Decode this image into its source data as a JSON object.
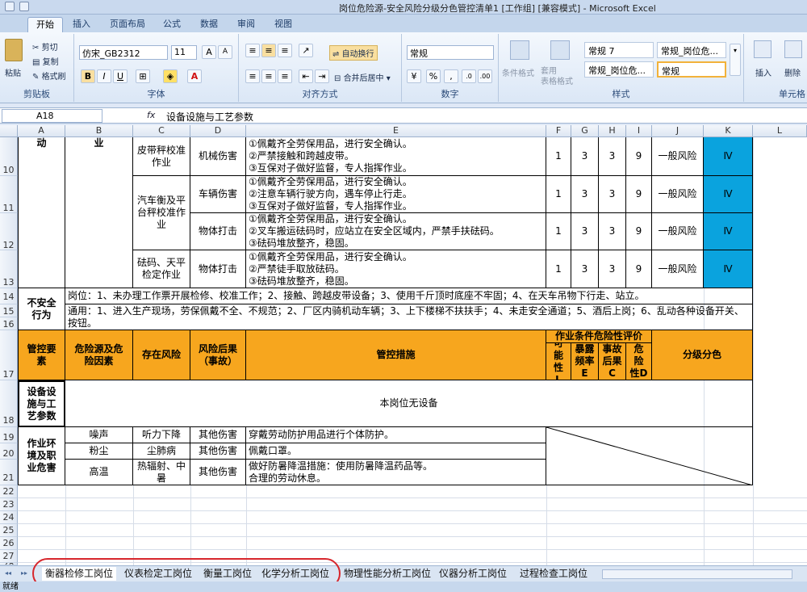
{
  "window": {
    "title": "岗位危险源-安全风险分级分色管控清单1 [工作组] [兼容模式] - Microsoft Excel"
  },
  "ribbon_tabs": [
    "开始",
    "插入",
    "页面布局",
    "公式",
    "数据",
    "审阅",
    "视图"
  ],
  "clipboard": {
    "paste": "粘贴",
    "cut": "剪切",
    "copy": "复制",
    "format_painter": "格式刷",
    "label": "剪贴板"
  },
  "font": {
    "name": "仿宋_GB2312",
    "size": "11",
    "bold": "B",
    "italic": "I",
    "underline": "U",
    "label": "字体"
  },
  "alignment": {
    "wrap": "自动换行",
    "merge": "合并后居中",
    "label": "对齐方式"
  },
  "number": {
    "format": "常规",
    "label": "数字"
  },
  "styles": {
    "cond_format": "条件格式",
    "table_format": "套用\n表格格式",
    "cells": [
      "常规 7",
      "常规_岗位危...",
      "常规_岗位危...",
      "常规"
    ],
    "label": "样式"
  },
  "cells_group": {
    "insert": "插入",
    "delete": "删除",
    "label": "单元格"
  },
  "formula_bar": {
    "name_box": "A18",
    "fx": "fx",
    "content": "设备设施与工艺参数"
  },
  "columns": [
    "A",
    "B",
    "C",
    "D",
    "E",
    "F",
    "G",
    "H",
    "I",
    "J",
    "K",
    "L"
  ],
  "rows": [
    "10",
    "11",
    "12",
    "13",
    "14",
    "15",
    "16",
    "17",
    "18",
    "19",
    "20",
    "21",
    "22",
    "23",
    "24",
    "25",
    "26",
    "27",
    "28"
  ],
  "sheet": {
    "a_top": "动",
    "b_top": "业",
    "r10": {
      "hazard": "皮带秤校准作业",
      "risk": "机械伤害",
      "measures": "①佩戴齐全劳保用品，进行安全确认。\n②严禁接触和跨越皮带。\n③互保对子做好监督，专人指挥作业。",
      "L": "1",
      "E": "3",
      "C": "3",
      "D": "9",
      "level": "一般风险",
      "grade": "Ⅳ"
    },
    "r11": {
      "hazard": "汽车衡及平台秤校准作业",
      "risk": "车辆伤害",
      "measures": "①佩戴齐全劳保用品，进行安全确认。\n②注意车辆行驶方向，遇车停止行走。\n③互保对子做好监督，专人指挥作业。",
      "L": "1",
      "E": "3",
      "C": "3",
      "D": "9",
      "level": "一般风险",
      "grade": "Ⅳ"
    },
    "r12": {
      "risk": "物体打击",
      "measures": "①佩戴齐全劳保用品，进行安全确认。\n②叉车搬运砝码时，应站立在安全区域内，严禁手扶砝码。\n③砝码堆放整齐，稳固。",
      "L": "1",
      "E": "3",
      "C": "3",
      "D": "9",
      "level": "一般风险",
      "grade": "Ⅳ"
    },
    "r13": {
      "hazard": "砝码、天平检定作业",
      "risk": "物体打击",
      "measures": "①佩戴齐全劳保用品，进行安全确认。\n②严禁徒手取放砝码。\n③砝码堆放整齐，稳固。",
      "L": "1",
      "E": "3",
      "C": "3",
      "D": "9",
      "level": "一般风险",
      "grade": "Ⅳ"
    },
    "unsafe": {
      "label": "不安全行为",
      "post": "岗位：1、未办理工作票开展检修、校准工作；2、接触、跨越皮带设备；3、使用千斤顶时底座不牢固；4、在天车吊物下行走、站立。",
      "general": "通用：1、进入生产现场，劳保佩戴不全、不规范；2、厂区内骑机动车辆；3、上下楼梯不扶扶手；4、未走安全通道；5、酒后上岗；6、乱动各种设备开关、按钮。"
    },
    "header": {
      "a": "管控要素",
      "b": "危险源及危险因素",
      "c": "存在风险",
      "d": "风险后果（事故）",
      "e": "管控措施",
      "fi": "作业条件危险性评价",
      "f": "可能性L",
      "g": "暴露频率E",
      "h": "事故后果C",
      "i": "危险性D",
      "jk": "分级分色"
    },
    "equip": {
      "label": "设备设施与工艺参数",
      "text": "本岗位无设备"
    },
    "env": {
      "label": "作业环境及职业危害",
      "rows": [
        {
          "b": "噪声",
          "c": "听力下降",
          "d": "其他伤害",
          "e": "穿戴劳动防护用品进行个体防护。"
        },
        {
          "b": "粉尘",
          "c": "尘肺病",
          "d": "其他伤害",
          "e": "佩戴口罩。"
        },
        {
          "b": "高温",
          "c": "热辐射、中暑",
          "d": "其他伤害",
          "e": "做好防暑降温措施：使用防暑降温药品等。\n合理的劳动休息。"
        }
      ]
    }
  },
  "sheet_tabs": [
    "衡器检修工岗位",
    "仪表检定工岗位",
    "衡量工岗位",
    "化学分析工岗位",
    "物理性能分析工岗位",
    "仪器分析工岗位",
    "过程检查工岗位"
  ],
  "status": {
    "text": "就绪"
  },
  "colors": {
    "orange": "#f7a61e",
    "blue": "#0aa3de",
    "highlight": "#d7262c"
  }
}
